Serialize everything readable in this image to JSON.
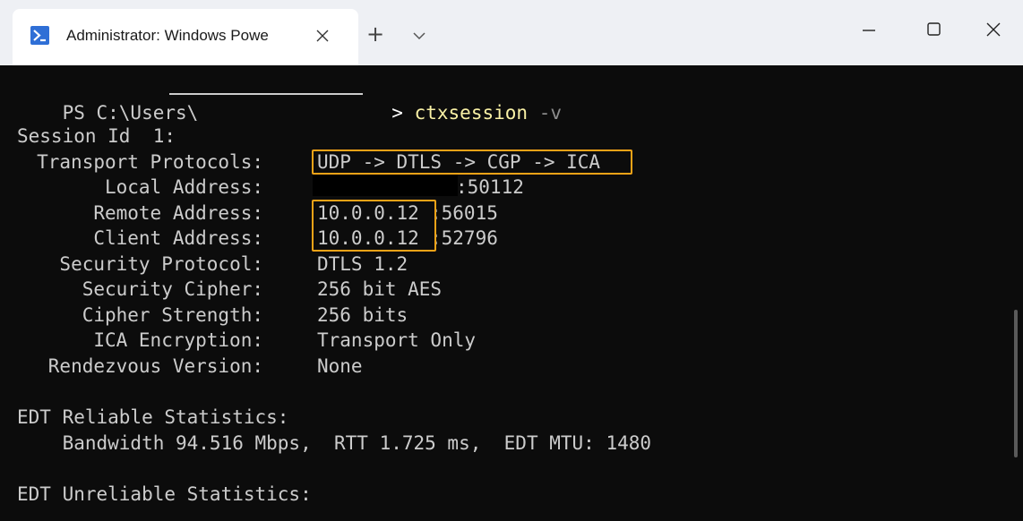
{
  "window": {
    "tab_title": "Administrator: Windows Powe",
    "tab_icon": "powershell-icon",
    "close_tab_icon": "close-icon",
    "new_tab_label": "+",
    "dropdown_icon": "chevron-down-icon",
    "controls": [
      "minimize-icon",
      "maximize-icon",
      "close-icon"
    ]
  },
  "colors": {
    "terminal_bg": "#0c0c0c",
    "text": "#cccccc",
    "command": "#f9f1a5",
    "highlight_box": "#f5a317",
    "titlebar_bg": "#eef0f4"
  },
  "prompt": {
    "prefix": "PS C:\\Users\\",
    "suffix": ">",
    "command": "ctxsession",
    "argument": "-v"
  },
  "session": {
    "header": "Session Id  1:",
    "fields": [
      {
        "label": "Transport Protocols:",
        "value": "UDP -> DTLS -> CGP -> ICA"
      },
      {
        "label": "Local Address:",
        "value": ":50112"
      },
      {
        "label": "Remote Address:",
        "value_ip": "10.0.0.12",
        "value_port": ":56015"
      },
      {
        "label": "Client Address:",
        "value_ip": "10.0.0.12",
        "value_port": ":52796"
      },
      {
        "label": "Security Protocol:",
        "value": "DTLS 1.2"
      },
      {
        "label": "Security Cipher:",
        "value": "256 bit AES"
      },
      {
        "label": "Cipher Strength:",
        "value": "256 bits"
      },
      {
        "label": "ICA Encryption:",
        "value": "Transport Only"
      },
      {
        "label": "Rendezvous Version:",
        "value": "None"
      }
    ]
  },
  "edt_reliable": {
    "header": "EDT Reliable Statistics:",
    "stats": "    Bandwidth 94.516 Mbps,  RTT 1.725 ms,  EDT MTU: 1480"
  },
  "edt_unreliable": {
    "header": "EDT Unreliable Statistics:"
  }
}
